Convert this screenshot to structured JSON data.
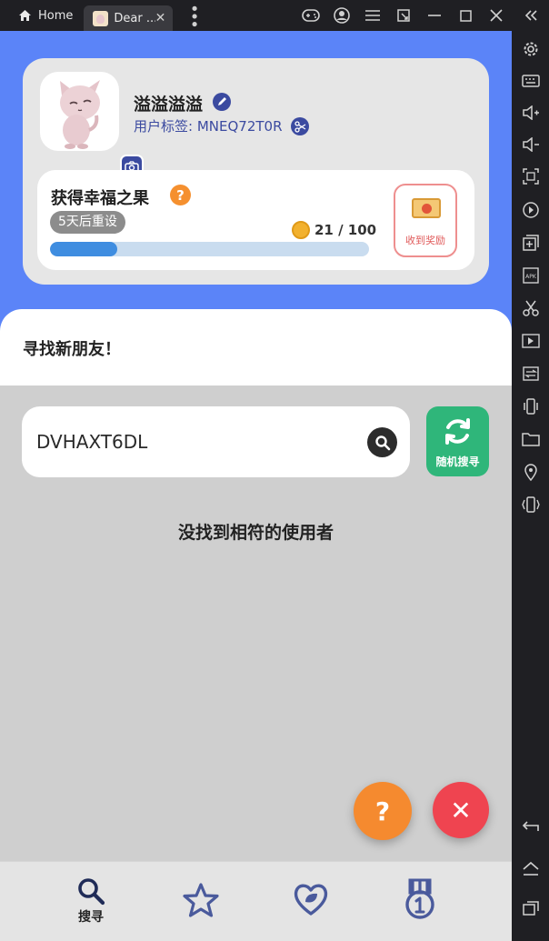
{
  "titlebar": {
    "home_tab": "Home",
    "app_tab": "Dear ...",
    "tab_close": "✕"
  },
  "profile": {
    "name": "溢溢溢溢",
    "tag_label": "用户标签: ",
    "tag_value": "MNEQ72T0R"
  },
  "reward": {
    "title": "获得幸福之果",
    "reset_text": "5天后重设",
    "progress_text": "21 / 100",
    "progress_value": 21,
    "progress_max": 100,
    "claim_label": "收到奖励"
  },
  "search": {
    "section_title": "寻找新朋友！",
    "input_value": "DVHAXT6DL",
    "random_label": "随机搜寻",
    "empty_message": "没找到相符的使用者"
  },
  "fabs": {
    "help": "?",
    "close": "✕"
  },
  "bottom_nav": {
    "items": [
      {
        "label": "搜寻",
        "icon": "search-icon"
      },
      {
        "label": "",
        "icon": "star-icon"
      },
      {
        "label": "",
        "icon": "heart-leaf-icon"
      },
      {
        "label": "",
        "icon": "rank-medal-icon"
      }
    ]
  },
  "colors": {
    "header_blue": "#5b84f8",
    "accent_navy": "#3b4aa0",
    "green": "#2fb67a",
    "orange": "#f58a2f",
    "red": "#ef4450"
  }
}
